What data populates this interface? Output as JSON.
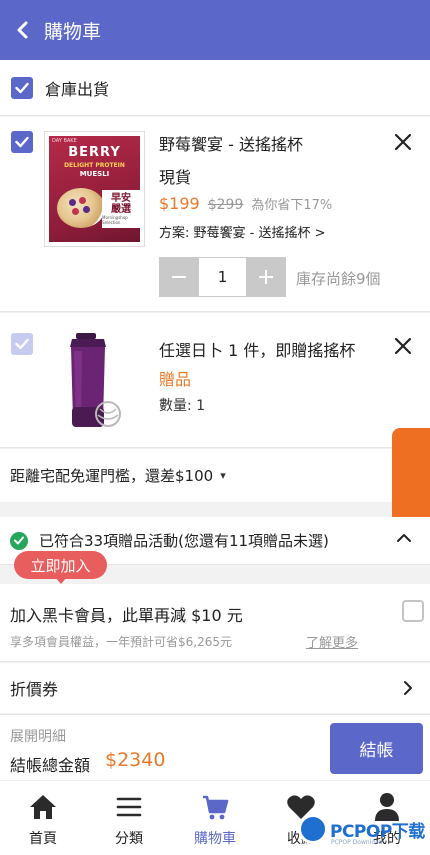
{
  "colors": {
    "brand": "#5b68c9",
    "price": "#e8792a",
    "success": "#26a65b",
    "badge": "#e85d5d",
    "float_tab": "#ef6f22"
  },
  "header": {
    "title": "購物車",
    "back_icon": "chevron-left-icon"
  },
  "warehouse": {
    "label": "倉庫出貨",
    "checked": true
  },
  "items": [
    {
      "checked": true,
      "image_text": {
        "top": "DAY BAKE",
        "line1": "BERRY",
        "line2": "DELIGHT PROTEIN",
        "line3": "MUESLI",
        "tag_line1": "早安",
        "tag_line2": "嚴選",
        "tag_sub": "Morningshop Selection"
      },
      "title": "野莓饗宴 - 送搖搖杯",
      "stock": "現貨",
      "price": "$199",
      "original_price": "$299",
      "saving": "為你省下17%",
      "plan": "方案: 野莓饗宴 - 送搖搖杯 >",
      "quantity": "1",
      "remaining": "庫存尚餘9個"
    },
    {
      "checked": true,
      "title": "任選日卜 1 件，即贈搖搖杯",
      "tag": "贈品",
      "quantity_text": "數量: 1"
    }
  ],
  "shipping": {
    "text": "距離宅配免運門檻，還差$100",
    "caret": "▾"
  },
  "gift_events": {
    "text": "已符合33項贈品活動(您還有11項贈品未選)"
  },
  "join_badge": {
    "label": "立即加入"
  },
  "membership": {
    "title": "加入黑卡會員，此單再減 $10 元",
    "subtitle": "享多項會員權益，一年預計可省$6,265元",
    "learn_more": "了解更多",
    "checked": false
  },
  "coupon": {
    "label": "折價券"
  },
  "checkout": {
    "expand_label": "展開明細",
    "total_label": "結帳總金額",
    "total_amount": "$2340",
    "button_label": "結帳"
  },
  "tabbar": [
    {
      "label": "首頁",
      "icon": "home-icon",
      "active": false
    },
    {
      "label": "分類",
      "icon": "menu-icon",
      "active": false
    },
    {
      "label": "購物車",
      "icon": "cart-icon",
      "active": true
    },
    {
      "label": "收藏",
      "icon": "heart-icon",
      "active": false
    },
    {
      "label": "我的",
      "icon": "user-icon",
      "active": false
    }
  ],
  "watermark": {
    "text": "PCPOP下载",
    "sub": "PCPOP Download"
  }
}
